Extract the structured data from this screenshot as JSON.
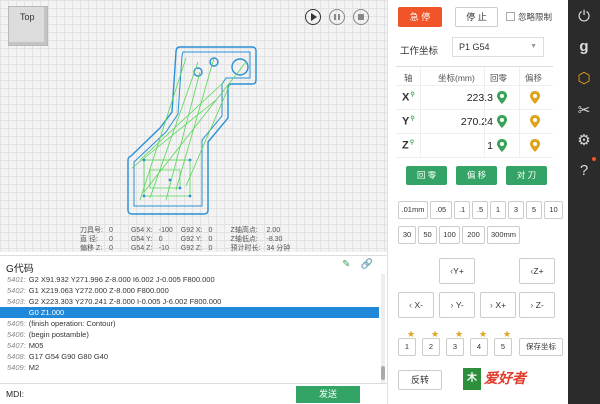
{
  "viewport": {
    "view_cube_label": "Top",
    "info": {
      "rows": [
        [
          "刀具号:",
          "0",
          "G54 X:",
          "-100",
          "G92 X:",
          "0",
          "Z轴高点:",
          "2.00"
        ],
        [
          "直  径:",
          "0",
          "G54 Y:",
          "0",
          "G92 Y:",
          "0",
          "Z轴低点:",
          "-8.30"
        ],
        [
          "偏移 Z:",
          "0",
          "G54 Z:",
          "-10",
          "G92 Z:",
          "0",
          "预计时长:",
          "34 分钟"
        ]
      ]
    }
  },
  "gcode": {
    "title": "G代码",
    "lines": [
      {
        "num": "5401:",
        "text": "G2 X91.932 Y271.996 Z-8.000 I6.002 J-0.005 F800.000"
      },
      {
        "num": "5402:",
        "text": "G1 X219.063 Y272.000 Z-8.000 F800.000"
      },
      {
        "num": "5403:",
        "text": "G2 X223.303 Y270.241 Z-8.000 I-0.005 J-6.002 F800.000"
      },
      {
        "num": "5404:",
        "text": "G0 Z1.000",
        "selected": true
      },
      {
        "num": "5405:",
        "text": "(finish operation: Contour)"
      },
      {
        "num": "5406:",
        "text": "(begin postamble)"
      },
      {
        "num": "5407:",
        "text": "M05"
      },
      {
        "num": "5408:",
        "text": "G17 G54 G90 G80 G40"
      },
      {
        "num": "5409:",
        "text": "M2"
      }
    ]
  },
  "mdi": {
    "label": "MDI:",
    "value": "",
    "send_label": "发送"
  },
  "side": {
    "estop_label": "急 停",
    "stop_label": "停 止",
    "ignore_limit_label": "忽略限制",
    "wcs_label": "工作坐标",
    "wcs_value": "P1 G54",
    "coord_headers": {
      "axis": "轴",
      "coord": "坐标(mm)",
      "home": "回零",
      "offset": "偏移"
    },
    "axes": [
      {
        "name": "X",
        "value": "223.3"
      },
      {
        "name": "Y",
        "value": "270.24"
      },
      {
        "name": "Z",
        "value": "1"
      }
    ],
    "action_buttons": [
      "回 零",
      "偏 移",
      "对 刀"
    ],
    "steps_row1": [
      ".01mm",
      ".05",
      ".1",
      ".5",
      "1",
      "3",
      "5",
      "10"
    ],
    "steps_row2": [
      "30",
      "50",
      "100",
      "200",
      "300mm"
    ],
    "jog": {
      "y_plus": "Y+",
      "z_plus": "Z+",
      "x_minus": "X-",
      "y_minus": "Y-",
      "x_plus": "X+",
      "z_minus": "Z-"
    },
    "presets": [
      "1",
      "2",
      "3",
      "4",
      "5"
    ],
    "save_coord_label": "保存坐标",
    "reverse_label": "反转",
    "logo_text": "爱好者",
    "logo_badge": "木"
  },
  "colors": {
    "estop": "#f05428",
    "green": "#33a466",
    "selected_line": "#1f88d9",
    "rail": "#2b2b2b",
    "star": "#e0a21a"
  },
  "rail_icons": [
    "power-icon",
    "google-icon",
    "cube-icon",
    "tools-icon",
    "gears-icon",
    "help-icon"
  ]
}
